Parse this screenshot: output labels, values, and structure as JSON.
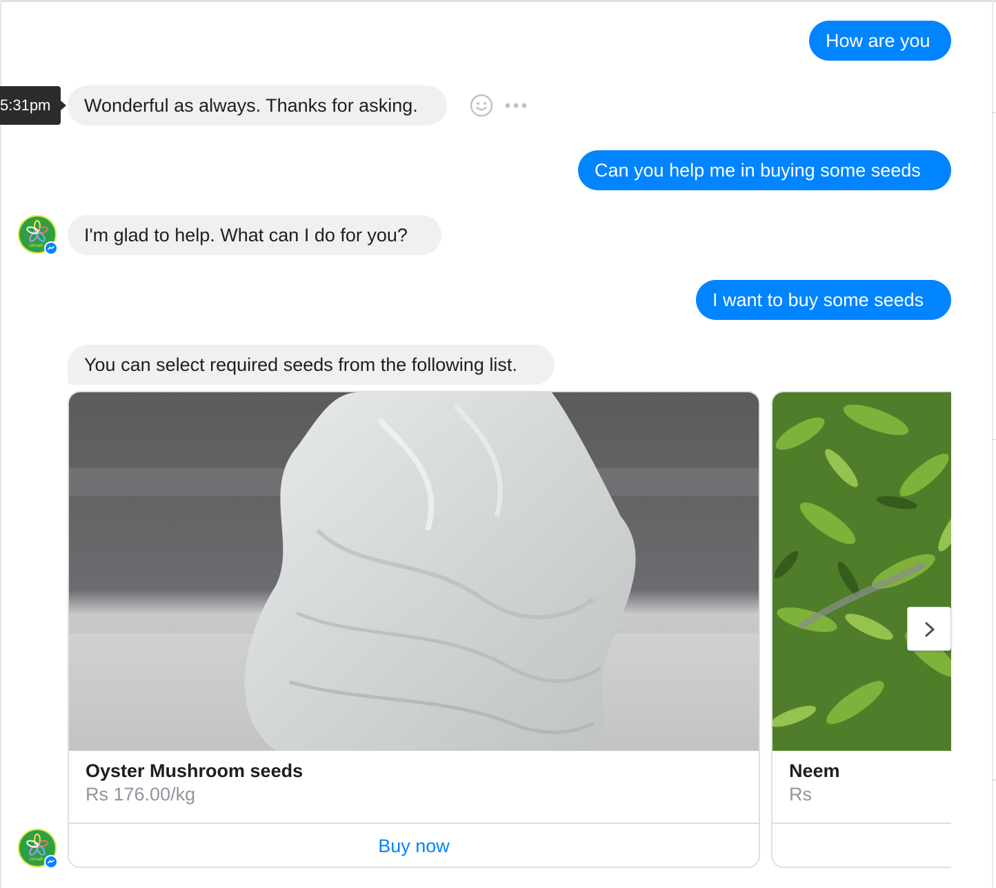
{
  "conversation": {
    "messages": [
      {
        "from": "user",
        "text": "How are you"
      },
      {
        "from": "bot",
        "text": "Wonderful as always. Thanks for asking."
      },
      {
        "from": "user",
        "text": "Can you help me in buying some seeds"
      },
      {
        "from": "bot",
        "text": "I'm glad to help. What can I do for you?"
      },
      {
        "from": "user",
        "text": "I want to buy some seeds"
      },
      {
        "from": "bot",
        "text": "You can select required seeds from the following list."
      }
    ],
    "hover_timestamp": "5:31pm",
    "message_actions": [
      "smiley-react-icon",
      "more-options-icon"
    ]
  },
  "bot": {
    "avatar_text": "Unnati",
    "avatar_icon": "flower-logo-icon",
    "badge_icon": "messenger-badge-icon"
  },
  "carousel": {
    "cards": [
      {
        "title": "Oyster Mushroom seeds",
        "subtitle": "Rs 176.00/kg",
        "button": "Buy now",
        "image": "mushroom-seed-bag-image"
      },
      {
        "title": "Neem",
        "subtitle": "Rs",
        "button": "",
        "image": "neem-leaves-image"
      }
    ],
    "next_icon": "chevron-right-icon"
  },
  "colors": {
    "user_bubble": "#0084ff",
    "bot_bubble": "#f0f0f0",
    "link": "#0084ff",
    "timestamp_bg": "#2b2b2b",
    "avatar_bg": "#2ea043"
  }
}
